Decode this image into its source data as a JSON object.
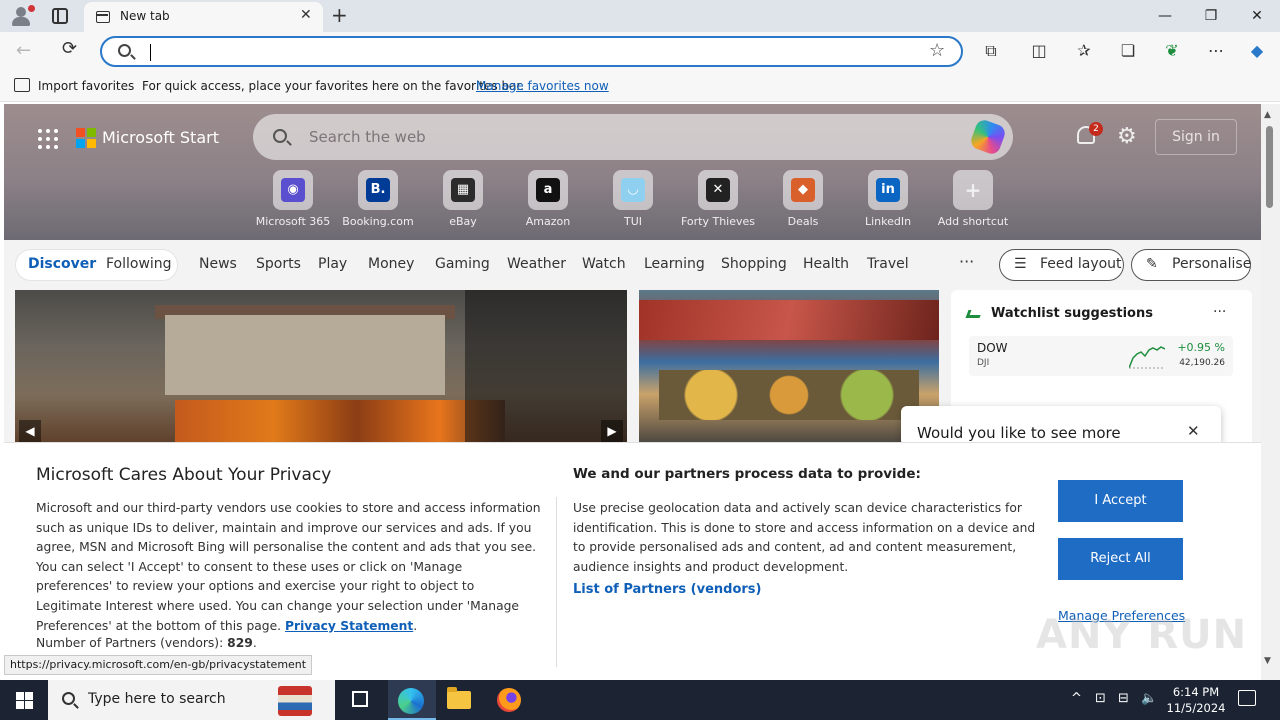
{
  "browser": {
    "tab_title": "New tab",
    "tab_close": "✕",
    "new_tab": "+",
    "window": {
      "minimize": "—",
      "maximize": "❐",
      "close": "✕"
    },
    "toolbar": {
      "back": "←",
      "reload": "⟳",
      "favorite_star": "☆",
      "icons": [
        "extensions-icon",
        "split-screen-icon",
        "favorites-icon",
        "collections-icon",
        "performance-icon",
        "settings-more-icon",
        "copilot-icon"
      ],
      "icon_glyphs": [
        "⧉",
        "◫",
        "✰",
        "❏",
        "❦",
        "⋯",
        "◆"
      ]
    },
    "favorites_bar": {
      "import_label": "Import favorites",
      "message": "For quick access, place your favorites here on the favorites bar.",
      "manage_link": "Manage favorites now"
    },
    "status_url": "https://privacy.microsoft.com/en-gb/privacystatement"
  },
  "start_page": {
    "brand": "Microsoft Start",
    "search_placeholder": "Search the web",
    "notification_count": "2",
    "settings_glyph": "⚙",
    "sign_in": "Sign in",
    "shortcuts": [
      {
        "label": "Microsoft 365",
        "glyph": "◉",
        "color": "#5a4fcf"
      },
      {
        "label": "Booking.com",
        "glyph": "B.",
        "color": "#003b95"
      },
      {
        "label": "eBay",
        "glyph": "▦",
        "color": "#2b2b2b"
      },
      {
        "label": "Amazon",
        "glyph": "a",
        "color": "#111111"
      },
      {
        "label": "TUI",
        "glyph": "◡",
        "color": "#8fd0f0"
      },
      {
        "label": "Forty Thieves",
        "glyph": "✕",
        "color": "#222222"
      },
      {
        "label": "Deals",
        "glyph": "◆",
        "color": "#d9602b"
      },
      {
        "label": "LinkedIn",
        "glyph": "in",
        "color": "#0a66c2"
      },
      {
        "label": "Add shortcut",
        "glyph": "+",
        "color": "transparent"
      }
    ],
    "nav": {
      "discover": "Discover",
      "following": "Following",
      "items": [
        "News",
        "Sports",
        "Play",
        "Money",
        "Gaming",
        "Weather",
        "Watch",
        "Learning",
        "Shopping",
        "Health",
        "Travel"
      ],
      "more": "···",
      "feed_layout": "Feed layout",
      "personalise": "Personalise"
    },
    "carousel": {
      "prev": "◀",
      "next": "▶"
    },
    "watchlist": {
      "title": "Watchlist suggestions",
      "more": "···",
      "stock": {
        "symbol": "DOW",
        "sub": "DJI",
        "change": "+0.95 %",
        "value": "42,190.26"
      }
    },
    "popup": {
      "title": "Would you like to see more",
      "close": "✕"
    }
  },
  "privacy": {
    "title": "Microsoft Cares About Your Privacy",
    "body": "Microsoft and our third-party vendors use cookies to store and access information such as unique IDs to deliver, maintain and improve our services and ads. If you agree, MSN and Microsoft Bing will personalise the content and ads that you see. You can select 'I Accept' to consent to these uses or click on 'Manage preferences' to review your options and exercise your right to object to Legitimate Interest where used.  You can change your selection under 'Manage Preferences' at the bottom of this page.",
    "statement_link": "Privacy Statement",
    "partners_label": "Number of Partners (vendors):",
    "partners_count": "829",
    "heading2": "We and our partners process data to provide:",
    "body2": "Use precise geolocation data and actively scan device characteristics for identification. This is done to store and access information on a device and to provide personalised ads and content, ad and content measurement, audience insights and product development.",
    "vendors_link": "List of Partners (vendors)",
    "accept": "I Accept",
    "reject": "Reject All",
    "manage": "Manage Preferences"
  },
  "watermark": "ANY RUN",
  "taskbar": {
    "search_placeholder": "Type here to search",
    "tray_icons": [
      "^",
      "⊡",
      "⊟",
      "🔈"
    ],
    "time": "6:14 PM",
    "date": "11/5/2024"
  }
}
